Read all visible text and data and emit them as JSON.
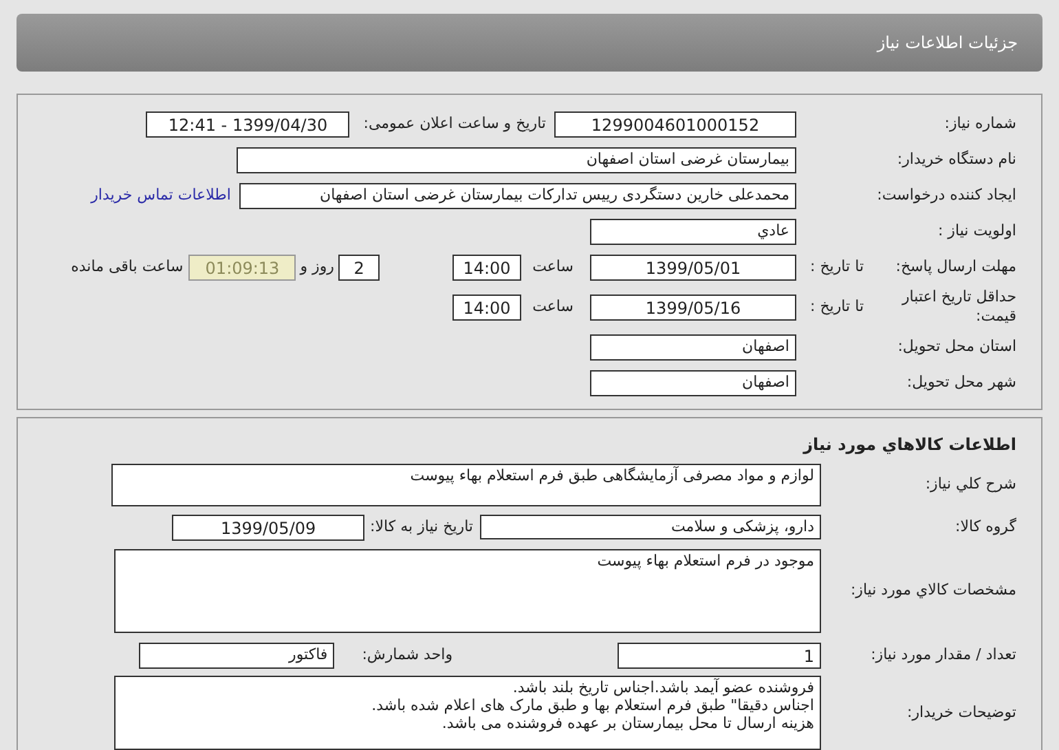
{
  "header": {
    "title": "جزئیات اطلاعات نیاز"
  },
  "request": {
    "need_number": {
      "label": "شماره نیاز:",
      "value": "1299004601000152"
    },
    "announce": {
      "label": "تاریخ و ساعت اعلان عمومی:",
      "value": "1399/04/30 - 12:41"
    },
    "buyer": {
      "label": "نام دستگاه خریدار:",
      "value": "بیمارستان غرضی استان اصفهان"
    },
    "creator": {
      "label": "ایجاد کننده درخواست:",
      "value": "محمدعلی خارین دستگردی رییس تدارکات بیمارستان غرضی استان اصفهان",
      "link": "اطلاعات تماس خریدار"
    },
    "priority": {
      "label": "اولویت نیاز :",
      "value": "عادي"
    },
    "deadline": {
      "label": "مهلت ارسال پاسخ:",
      "date_label": "تا تاریخ :",
      "date": "1399/05/01",
      "time_label": "ساعت",
      "time": "14:00",
      "days": "2",
      "days_label": "روز و",
      "remaining": "01:09:13",
      "remaining_label": "ساعت باقی مانده"
    },
    "validity": {
      "label": "حداقل تاریخ اعتبار قیمت:",
      "date_label": "تا تاریخ :",
      "date": "1399/05/16",
      "time_label": "ساعت",
      "time": "14:00"
    },
    "province": {
      "label": "استان محل تحویل:",
      "value": "اصفهان"
    },
    "city": {
      "label": "شهر محل تحویل:",
      "value": "اصفهان"
    }
  },
  "goods": {
    "title": "اطلاعات کالاهاي مورد نياز",
    "summary": {
      "label": "شرح کلي نياز:",
      "value": "لوازم و مواد مصرفی آزمایشگاهی طبق فرم استعلام بهاء پیوست"
    },
    "group": {
      "label": "گروه کالا:",
      "value": "دارو، پزشکی و سلامت",
      "date_label": "تاریخ نیاز به کالا:",
      "date": "1399/05/09"
    },
    "specs": {
      "label": "مشخصات کالاي مورد نياز:",
      "value": "موجود در فرم استعلام بهاء پیوست"
    },
    "quantity": {
      "label": "تعداد / مقدار مورد نیاز:",
      "value": "1",
      "unit_label": "واحد شمارش:",
      "unit": "فاکتور"
    },
    "notes": {
      "label": "توضیحات خریدار:",
      "lines": [
        "فروشنده عضو آیمد باشد.اجناس تاریخ بلند باشد.",
        "اجناس دقیقا\" طبق فرم استعلام بها و طبق مارک های اعلام شده باشد.",
        "هزینه ارسال تا محل بیمارستان بر عهده فروشنده می باشد."
      ]
    }
  }
}
